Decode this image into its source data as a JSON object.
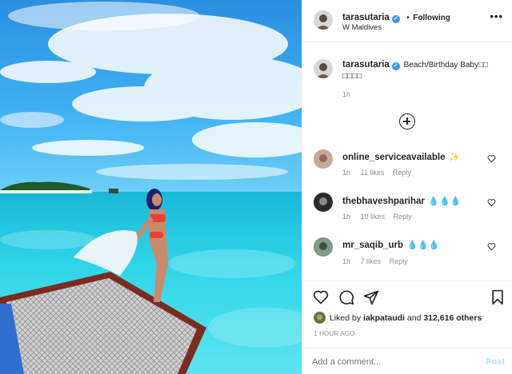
{
  "post": {
    "username": "tarasutaria",
    "follow_status": "Following",
    "location": "W Maldives",
    "caption": "Beach/Birthday Baby□□\n□□□□",
    "caption_line1": "Beach/Birthday Baby□□",
    "caption_line2": "□□□□",
    "caption_time": "1h"
  },
  "icons": {
    "more": "more-options-icon",
    "verified": "verified-badge-icon",
    "load_more": "add-circle-icon",
    "like": "heart-icon",
    "comment": "comment-icon",
    "share": "share-icon",
    "save": "bookmark-icon"
  },
  "comments": [
    {
      "username": "online_serviceavailable",
      "text": "✨",
      "time": "1h",
      "likes": "11 likes",
      "reply": "Reply"
    },
    {
      "username": "thebhaveshparihar",
      "text": "💧💧💧",
      "time": "1h",
      "likes": "10 likes",
      "reply": "Reply"
    },
    {
      "username": "mr_saqib_urb",
      "text": "💧💧💧",
      "time": "1h",
      "likes": "7 likes",
      "reply": "Reply"
    }
  ],
  "likes": {
    "prefix": "Liked by",
    "user": "iakpataudi",
    "middle": "and",
    "others": "312,616 others"
  },
  "timestamp": "1 HOUR AGO",
  "add_comment": {
    "placeholder": "Add a comment...",
    "post_label": "Post"
  },
  "colors": {
    "accent": "#3897f0",
    "post_disabled": "#b2dffc",
    "text": "#262626",
    "muted": "#8e8e8e"
  }
}
